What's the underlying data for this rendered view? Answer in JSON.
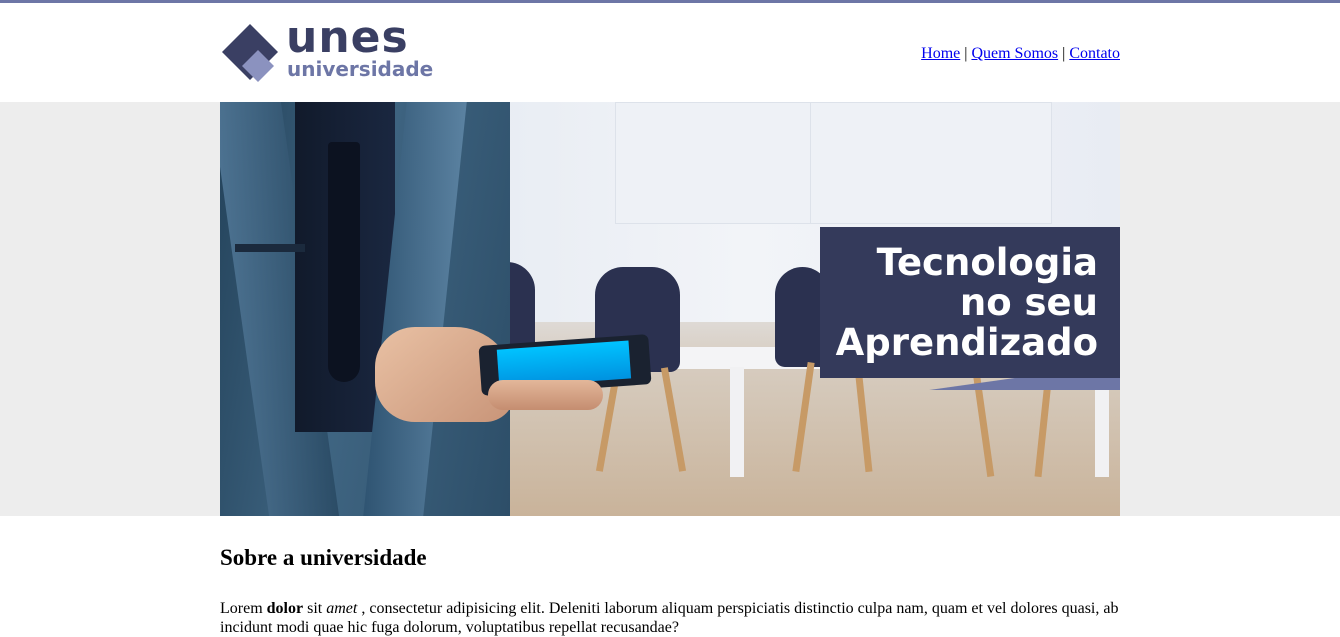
{
  "brand": {
    "name": "unes",
    "subtitle": "universidade",
    "colors": {
      "primary": "#343a5b",
      "accent": "#6d76a6"
    }
  },
  "nav": {
    "items": [
      {
        "label": "Home"
      },
      {
        "label": "Quem Somos"
      },
      {
        "label": "Contato"
      }
    ],
    "separator": "|"
  },
  "banner": {
    "headline": "Tecnologia\nno seu\nAprendizado"
  },
  "about": {
    "title": "Sobre a universidade",
    "text_lead": "Lorem ",
    "text_bold": "dolor",
    "text_mid": " sit ",
    "text_italic": "amet",
    "text_rest": " , consectetur adipisicing elit. Deleniti laborum aliquam perspiciatis distinctio culpa nam, quam et vel dolores quasi, ab incidunt modi quae hic fuga dolorum, voluptatibus repellat recusandae?"
  }
}
